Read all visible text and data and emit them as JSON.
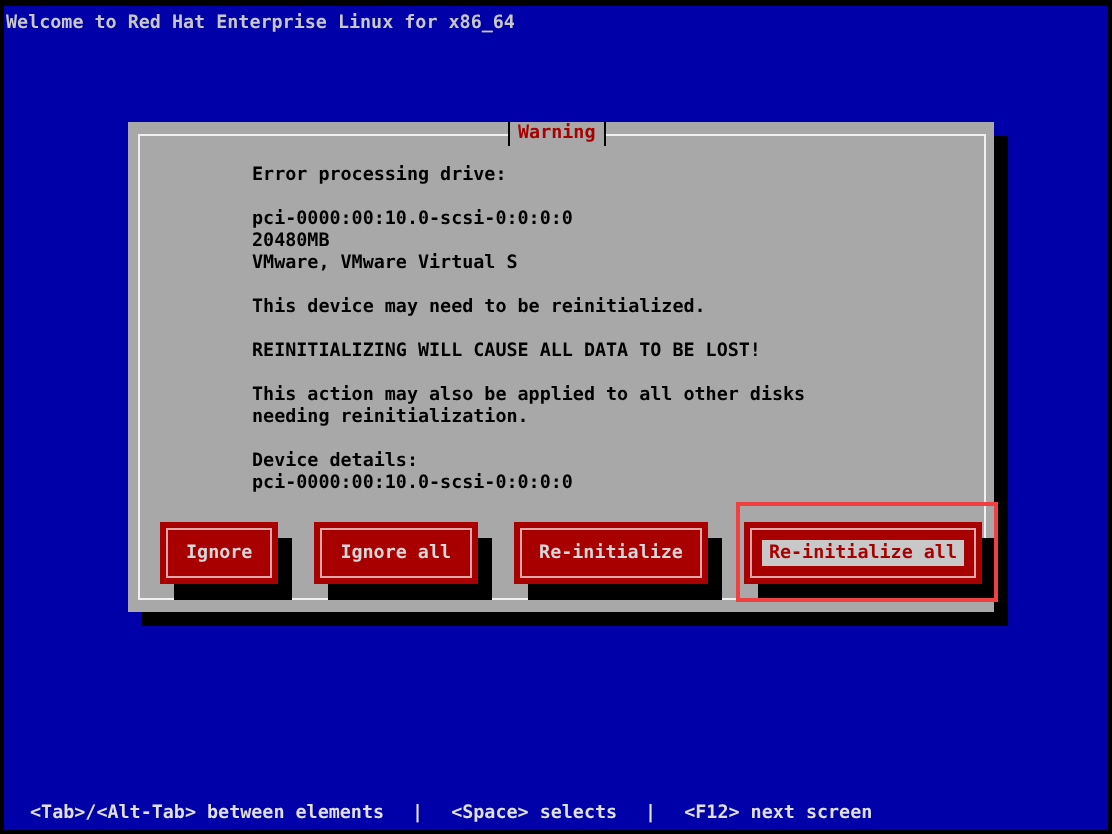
{
  "header": {
    "title": "Welcome to Red Hat Enterprise Linux for x86_64"
  },
  "dialog": {
    "title": "Warning",
    "paragraphs": [
      [
        "Error processing drive:"
      ],
      [
        "pci-0000:00:10.0-scsi-0:0:0:0",
        "20480MB",
        "VMware, VMware Virtual S"
      ],
      [
        "This device may need to be reinitialized."
      ],
      [
        "REINITIALIZING WILL CAUSE ALL DATA TO BE LOST!"
      ],
      [
        "This action may also be applied to all other disks",
        "needing reinitialization."
      ],
      [
        "Device details:",
        "pci-0000:00:10.0-scsi-0:0:0:0"
      ]
    ],
    "buttons": [
      {
        "label": "Ignore",
        "selected": false,
        "outlined": false
      },
      {
        "label": "Ignore all",
        "selected": false,
        "outlined": false
      },
      {
        "label": "Re-initialize",
        "selected": false,
        "outlined": false
      },
      {
        "label": "Re-initialize all",
        "selected": true,
        "outlined": true
      }
    ]
  },
  "status_bar": [
    "<Tab>/<Alt-Tab> between elements",
    "|",
    "<Space> selects",
    "|",
    "<F12> next screen"
  ]
}
